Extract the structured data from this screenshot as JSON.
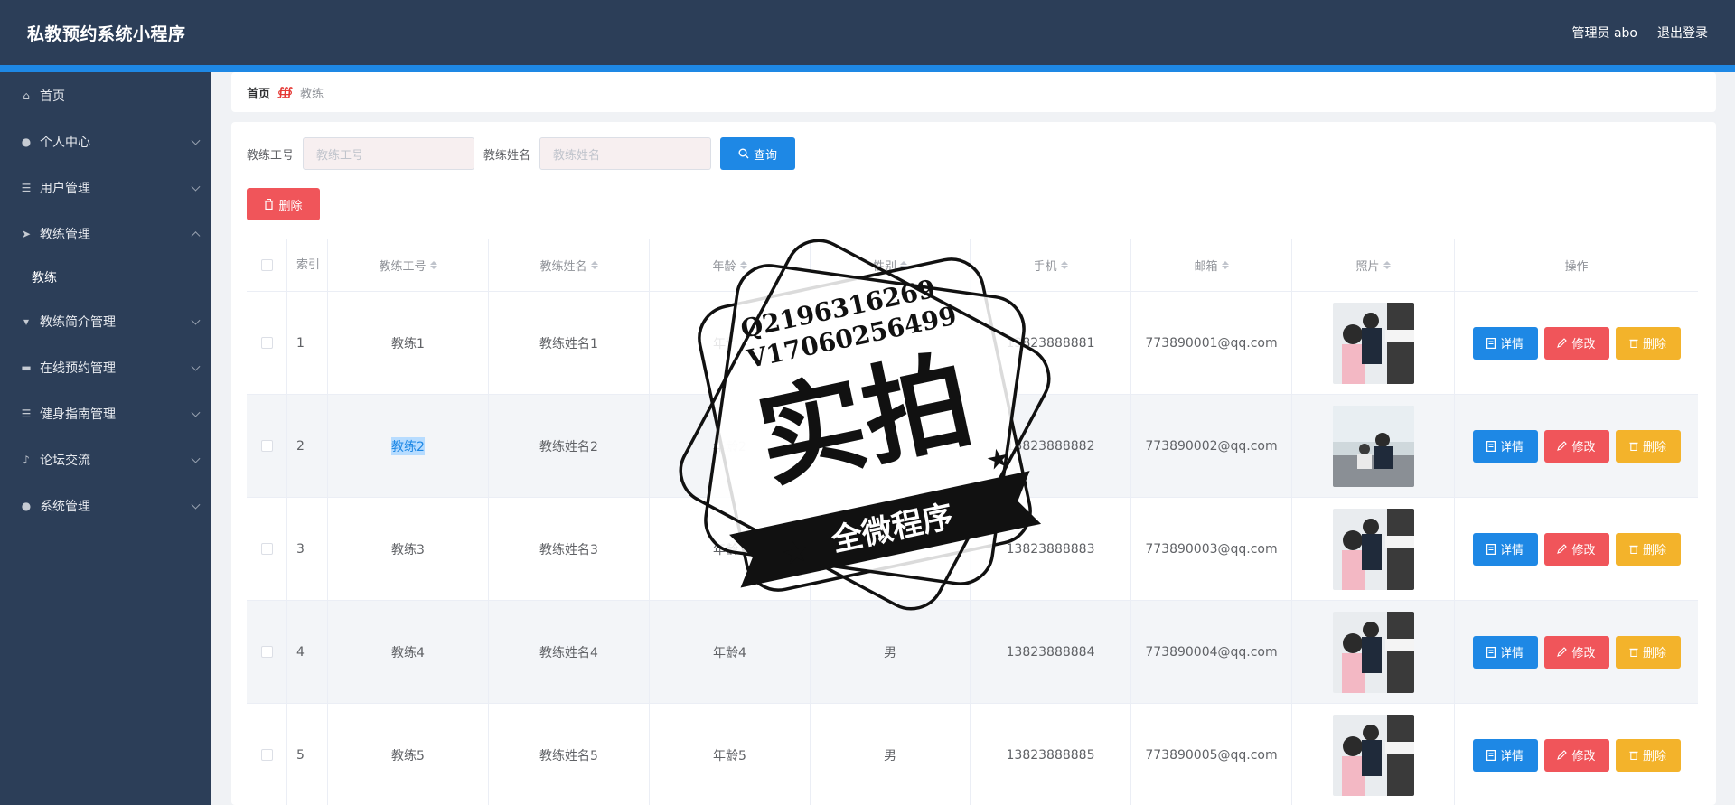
{
  "header": {
    "title": "私教预约系统小程序",
    "user": "管理员 abo",
    "logout": "退出登录"
  },
  "sidebar": {
    "items": [
      {
        "label": "首页",
        "icon": "home-icon",
        "glyph": "⌂",
        "arrow": ""
      },
      {
        "label": "个人中心",
        "icon": "user-icon",
        "glyph": "●",
        "arrow": "down"
      },
      {
        "label": "用户管理",
        "icon": "list-icon",
        "glyph": "☰",
        "arrow": "down"
      },
      {
        "label": "教练管理",
        "icon": "send-icon",
        "glyph": "➤",
        "arrow": "up"
      },
      {
        "label": "教练简介管理",
        "icon": "cup-icon",
        "glyph": "▾",
        "arrow": "down"
      },
      {
        "label": "在线预约管理",
        "icon": "chat-icon",
        "glyph": "▬",
        "arrow": "down"
      },
      {
        "label": "健身指南管理",
        "icon": "list-icon",
        "glyph": "☰",
        "arrow": "down"
      },
      {
        "label": "论坛交流",
        "icon": "mic-icon",
        "glyph": "♪",
        "arrow": "down"
      },
      {
        "label": "系统管理",
        "icon": "user-icon",
        "glyph": "●",
        "arrow": "down"
      }
    ],
    "sub_item": "教练"
  },
  "breadcrumb": {
    "home": "首页",
    "separator": "∰",
    "current": "教练"
  },
  "search": {
    "field1_label": "教练工号",
    "field1_placeholder": "教练工号",
    "field2_label": "教练姓名",
    "field2_placeholder": "教练姓名",
    "query_button": "查询"
  },
  "delete_button": "删除",
  "table": {
    "headers": [
      "索引",
      "教练工号",
      "教练姓名",
      "年龄",
      "性别",
      "手机",
      "邮箱",
      "照片",
      "操作"
    ],
    "rows": [
      {
        "index": "1",
        "no": "教练1",
        "name": "教练姓名1",
        "age": "年龄1",
        "gender": "",
        "phone": "13823888881",
        "email": "773890001@qq.com"
      },
      {
        "index": "2",
        "no": "教练2",
        "name": "教练姓名2",
        "age": "年龄2",
        "gender": "男",
        "phone": "13823888882",
        "email": "773890002@qq.com"
      },
      {
        "index": "3",
        "no": "教练3",
        "name": "教练姓名3",
        "age": "年龄3",
        "gender": "男",
        "phone": "13823888883",
        "email": "773890003@qq.com"
      },
      {
        "index": "4",
        "no": "教练4",
        "name": "教练姓名4",
        "age": "年龄4",
        "gender": "男",
        "phone": "13823888884",
        "email": "773890004@qq.com"
      },
      {
        "index": "5",
        "no": "教练5",
        "name": "教练姓名5",
        "age": "年龄5",
        "gender": "男",
        "phone": "13823888885",
        "email": "773890005@qq.com"
      }
    ],
    "actions": {
      "detail": "详情",
      "edit": "修改",
      "delete": "删除"
    }
  },
  "watermark": {
    "line1": "Q2196316269",
    "line2": "V17060256499",
    "big": "实拍",
    "banner": "全微程序"
  },
  "colors": {
    "header_bg": "#2c3e58",
    "accent": "#1e88e5",
    "danger": "#f0555a",
    "warning": "#f3b32b"
  }
}
